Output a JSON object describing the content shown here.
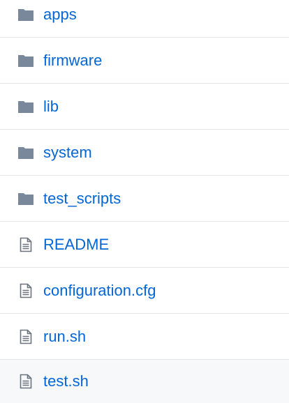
{
  "colors": {
    "link": "#0366d6",
    "folder_icon": "#79889a",
    "file_icon": "#6a737d",
    "divider": "#e4e6ea",
    "hover_row": "#f6f8fa"
  },
  "entries": [
    {
      "name": "apps",
      "icon": "folder-icon"
    },
    {
      "name": "firmware",
      "icon": "folder-icon"
    },
    {
      "name": "lib",
      "icon": "folder-icon"
    },
    {
      "name": "system",
      "icon": "folder-icon"
    },
    {
      "name": "test_scripts",
      "icon": "folder-icon"
    },
    {
      "name": "README",
      "icon": "file-icon"
    },
    {
      "name": "configuration.cfg",
      "icon": "file-icon"
    },
    {
      "name": "run.sh",
      "icon": "file-icon"
    },
    {
      "name": "test.sh",
      "icon": "file-icon"
    }
  ]
}
